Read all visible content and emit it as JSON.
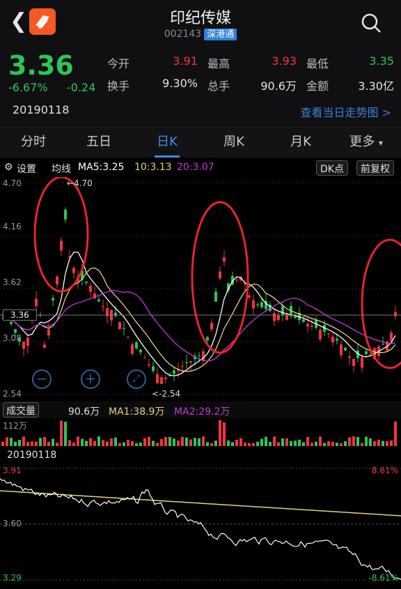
{
  "header": {
    "title": "印纪传媒",
    "code": "002143",
    "market_badge": "深港通"
  },
  "quote": {
    "price": "3.36",
    "change_pct": "-6.67%",
    "change_abs": "-0.24",
    "date": "20190118",
    "trend_link": "查看当日走势图 >",
    "fields": {
      "open_label": "今开",
      "open_value": "3.91",
      "high_label": "最高",
      "high_value": "3.93",
      "low_label": "最低",
      "low_value": "3.35",
      "turnover_label": "换手",
      "turnover_value": "9.30%",
      "volume_label": "总手",
      "volume_value": "90.6万",
      "amount_label": "金额",
      "amount_value": "3.30亿"
    }
  },
  "tabs": [
    "分时",
    "五日",
    "日K",
    "周K",
    "月K",
    "更多"
  ],
  "active_tab": "日K",
  "ma_bar": {
    "settings": "设置",
    "ma_label": "均线",
    "ma5": "MA5:3.25",
    "ma10": "10:3.13",
    "ma20": "20:3.07",
    "dk_button": "DK点",
    "adjust_button": "前复权"
  },
  "kline": {
    "y_labels": [
      "4.70",
      "4.16",
      "3.62",
      "3.08",
      "2.54"
    ],
    "current_price_label": "3.36",
    "high_marker": "←4.70",
    "low_marker": "<-2.54"
  },
  "volume_bar": {
    "button": "成交量",
    "value": "90.6万",
    "ma1": "MA1:38.9万",
    "ma2": "MA2:29.2万",
    "axis_max": "112万"
  },
  "intraday": {
    "date": "20190118",
    "high_price": "3.91",
    "mid_price": "3.60",
    "low_price": "3.29",
    "high_pct": "8.61%",
    "low_pct": "-8.61%"
  },
  "colors": {
    "up": "#f0363f",
    "down": "#2fc455",
    "accent": "#3b8ee8",
    "ma5": "#ffffff",
    "ma10": "#e8d27a",
    "ma20": "#c03ad8"
  }
}
